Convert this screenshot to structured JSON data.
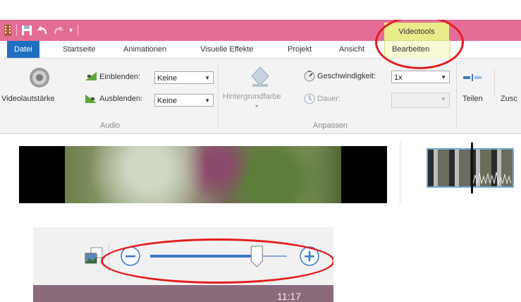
{
  "app": {
    "context_tab_header": "Videotools",
    "tabs": [
      {
        "label": "Datei"
      },
      {
        "label": "Startseite"
      },
      {
        "label": "Animationen"
      },
      {
        "label": "Visuelle Effekte"
      },
      {
        "label": "Projekt"
      },
      {
        "label": "Ansicht"
      },
      {
        "label": "Bearbeiten"
      }
    ]
  },
  "ribbon": {
    "audio": {
      "volume_label": "Videolautstärke",
      "fade_in_label": "Einblenden:",
      "fade_in_value": "Keine",
      "fade_out_label": "Ausblenden:",
      "fade_out_value": "Keine",
      "group_label": "Audio"
    },
    "adjust": {
      "background_label": "Hintergrundfarbe",
      "speed_label": "Geschwindigkeit:",
      "speed_value": "1x",
      "duration_label": "Dauer:",
      "duration_value": "",
      "group_label": "Anpassen"
    },
    "edit": {
      "split_label": "Teilen",
      "trim_label": "Zusc"
    }
  },
  "zoombar": {
    "clock": "11:17",
    "zoom_level": 0.78
  },
  "colors": {
    "titlebar": "#e36d97",
    "file_tab": "#1f6fc1",
    "context_tab": "#e9ec8a",
    "highlight": "#e41c1c",
    "slider": "#3b78c9"
  }
}
